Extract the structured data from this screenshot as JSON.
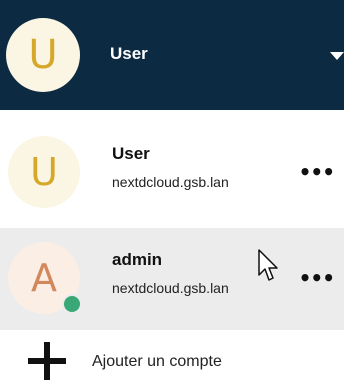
{
  "header": {
    "avatar_letter": "U",
    "user_name": "User",
    "caret_icon": "caret-down-icon"
  },
  "accounts": [
    {
      "avatar_letter": "U",
      "name": "User",
      "host": "nextdcloud.gsb.lan",
      "more": "•••",
      "online": false
    },
    {
      "avatar_letter": "A",
      "name": "admin",
      "host": "nextdcloud.gsb.lan",
      "more": "•••",
      "online": true
    }
  ],
  "add_account": {
    "icon": "plus-icon",
    "label": "Ajouter un compte"
  },
  "colors": {
    "header_bg": "#0c2a42",
    "avatar_user_bg": "#fbf6e3",
    "avatar_user_fg": "#d6a82a",
    "avatar_admin_bg": "#fbeee4",
    "avatar_admin_fg": "#d2875c",
    "status_online": "#3aa876",
    "hover_row_bg": "#ececec"
  }
}
